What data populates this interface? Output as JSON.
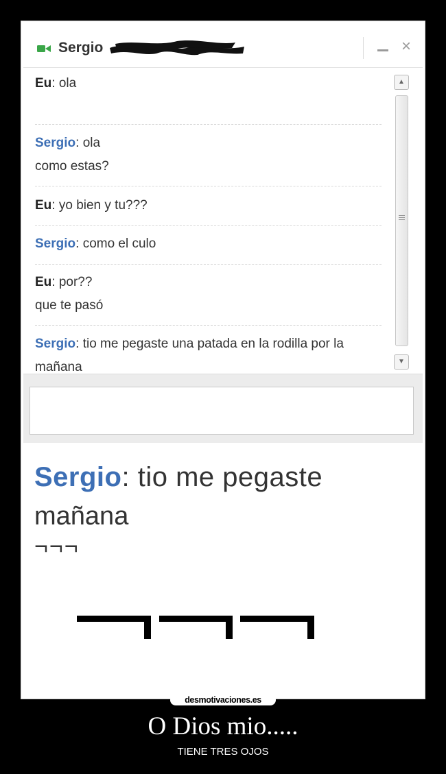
{
  "chat": {
    "contact_name": "Sergio",
    "messages": [
      {
        "sender": "Eu",
        "lines": [
          "ola"
        ]
      },
      {
        "sender": "Sergio",
        "lines": [
          "ola",
          "como estas?"
        ]
      },
      {
        "sender": "Eu",
        "lines": [
          "yo bien y tu???"
        ]
      },
      {
        "sender": "Sergio",
        "lines": [
          "como el culo"
        ]
      },
      {
        "sender": "Eu",
        "lines": [
          "por??",
          "que te pasó"
        ]
      },
      {
        "sender": "Sergio",
        "lines": [
          "tio me pegaste una patada en la rodilla por la",
          "mañana",
          "¬¬¬"
        ]
      }
    ],
    "input_value": ""
  },
  "zoom": {
    "sender": "Sergio",
    "line1": ": tio me pegaste",
    "line2": "mañana",
    "line3": "¬¬¬"
  },
  "poster": {
    "watermark": "desmotivaciones.es",
    "title": "O Dios mio.....",
    "subtitle": "TIENE TRES OJOS"
  },
  "colors": {
    "sergio_name": "#3d6fb5",
    "video_icon": "#3aa648",
    "background": "#000000"
  },
  "icons": [
    "video-camera-icon",
    "minimize-icon",
    "close-icon",
    "scroll-up-icon",
    "scroll-down-icon"
  ]
}
